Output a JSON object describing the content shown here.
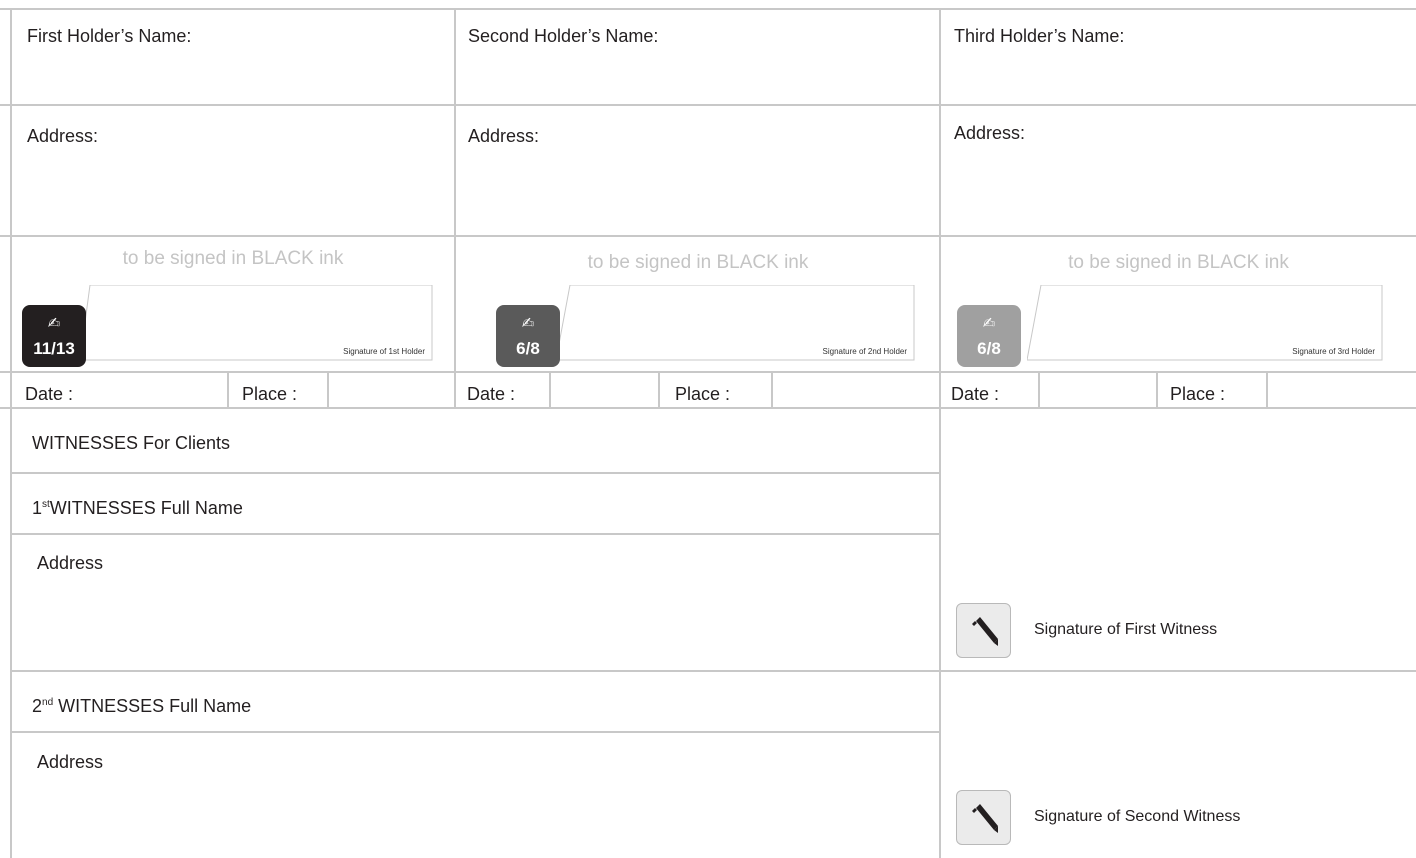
{
  "holders": [
    {
      "name_label": "First Holder’s Name:",
      "address_label": "Address:",
      "ink_note": "to be signed in BLACK ink",
      "badge_value": "11/13",
      "badge_color": "#231f20",
      "badge_icon": "no-writing-hand-icon",
      "signature_caption": "Signature of 1st Holder",
      "date_label": "Date :",
      "place_label": "Place :"
    },
    {
      "name_label": "Second Holder’s Name:",
      "address_label": "Address:",
      "ink_note": "to be signed in BLACK ink",
      "badge_value": "6/8",
      "badge_color": "#5a5a5a",
      "badge_icon": "no-writing-hand-icon",
      "signature_caption": "Signature of 2nd Holder",
      "date_label": "Date :",
      "place_label": "Place :"
    },
    {
      "name_label": "Third Holder’s Name:",
      "address_label": "Address:",
      "ink_note": "to be signed in BLACK ink",
      "badge_value": "6/8",
      "badge_color": "#a0a0a0",
      "badge_icon": "no-writing-hand-icon",
      "signature_caption": "Signature of 3rd Holder",
      "date_label": "Date :",
      "place_label": "Place :"
    }
  ],
  "witnesses": {
    "heading": "WITNESSES For Clients",
    "first": {
      "ordinal_number": "1",
      "ordinal_suffix": "st",
      "name_label": "WITNESSES Full Name",
      "address_label": "Address",
      "signature_caption": "Signature of First Witness",
      "button_icon": "pencil-icon"
    },
    "second": {
      "ordinal_number": "2",
      "ordinal_suffix": "nd",
      "name_label": " WITNESSES Full Name",
      "address_label": "Address",
      "signature_caption": "Signature of Second Witness",
      "button_icon": "pencil-icon"
    }
  },
  "colors": {
    "border": "#c8c8c8",
    "ink_note": "#c4c4c4",
    "text": "#231f20"
  }
}
